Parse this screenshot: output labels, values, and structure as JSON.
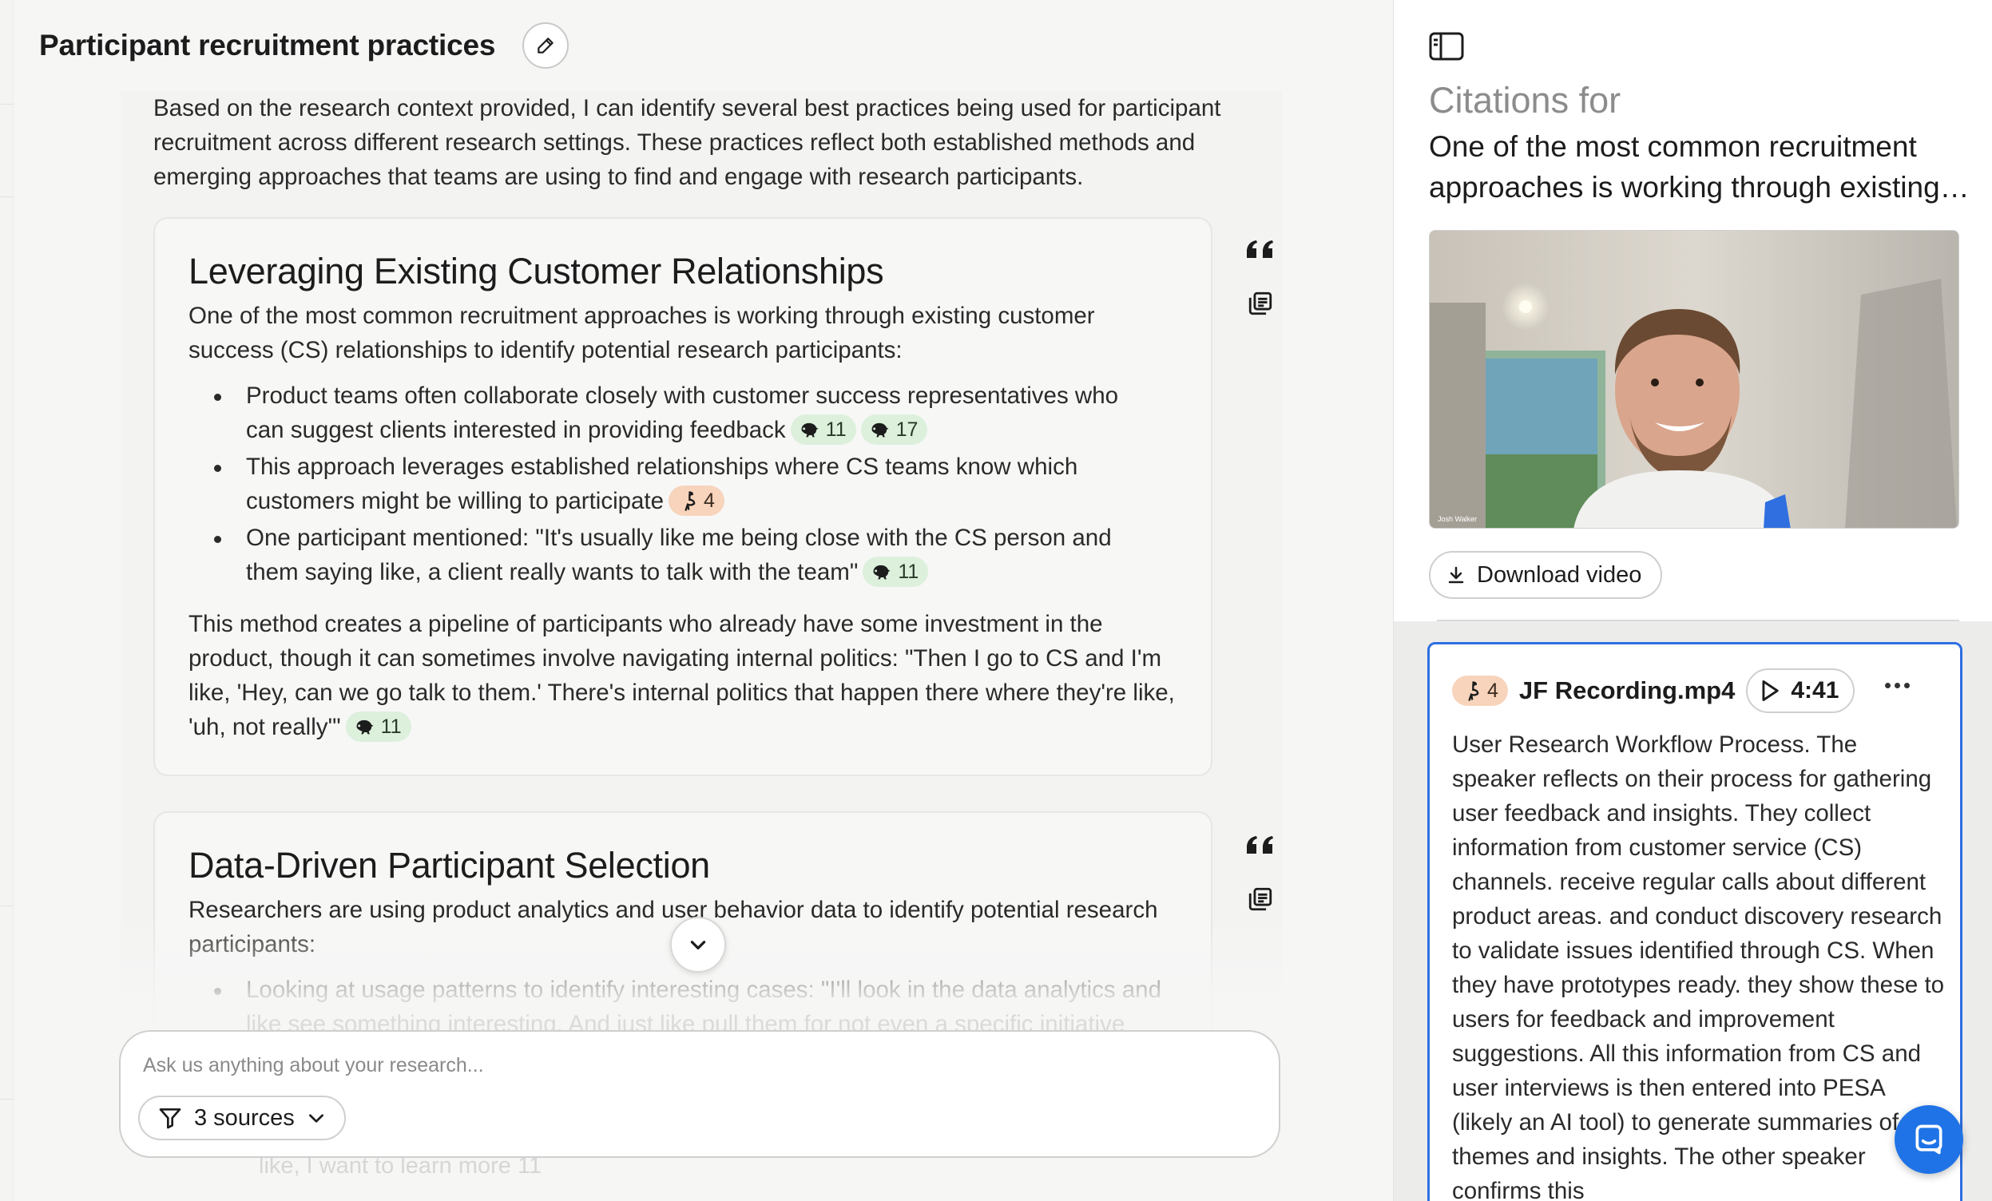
{
  "page": {
    "title": "Participant recruitment practices"
  },
  "chat": {
    "intro": "Based on the research context provided, I can identify several best practices being used for participant recruitment across different research settings. These practices reflect both established methods and emerging approaches that teams are using to find and engage with research participants.",
    "sections": [
      {
        "heading": "Leveraging Existing Customer Relationships",
        "lead": "One of the most common recruitment approaches is working through existing customer success (CS) relationships to identify potential research participants:",
        "bullets": [
          "Product teams often collaborate closely with customer success representatives who can suggest clients interested in providing feedback",
          "This approach leverages established relationships where CS teams know which customers might be willing to participate",
          "One participant mentioned: \"It's usually like me being close with the CS person and them saying like, a client really wants to talk with the team\""
        ],
        "chips": {
          "b1a": "11",
          "b1b": "17",
          "b2": "4",
          "b3": "11",
          "closing": "11"
        },
        "closing": "This method creates a pipeline of participants who already have some investment in the product, though it can sometimes involve navigating internal politics: \"Then I go to CS and I'm like, 'Hey, can we go talk to them.' There's internal politics that happen there where they're like, 'uh, not really'\""
      },
      {
        "heading": "Data-Driven Participant Selection",
        "lead": "Researchers are using product analytics and user behavior data to identify potential research participants:",
        "bullets": [
          "Looking at usage patterns to identify interesting cases: \"I'll look in the data analytics and like see something interesting. And just like pull them for not even a specific initiative"
        ]
      }
    ],
    "ghost_text": "like, I want to learn more",
    "ghost_chip": "11"
  },
  "composer": {
    "placeholder": "Ask us anything about your research...",
    "sources_label": "3 sources"
  },
  "citations": {
    "label": "Citations for",
    "quote_line1": "One of the most common recruitment",
    "quote_line2": "approaches is working through existing customer success",
    "video_person_name": "Josh Walker",
    "download_label": "Download video",
    "card": {
      "chip_count": "4",
      "filename": "JF Recording.mp4",
      "timestamp": "4:41",
      "summary": "User Research Workflow Process. The speaker reflects on their process for gathering user feedback and insights. They collect information from customer service (CS) channels. receive regular calls about different product areas. and conduct discovery research to validate issues identified through CS. When they have prototypes ready. they show these to users for feedback and improvement suggestions. All this information from CS and user interviews is then entered into PESA (likely an AI tool) to generate summaries of themes and insights. The other speaker confirms this"
    }
  },
  "icons": {
    "edit": "pencil-icon",
    "quote": "quote-icon",
    "copy": "copy-icon",
    "chevron": "chevron-down-icon",
    "filter": "filter-icon",
    "panel": "sidebar-toggle-icon",
    "download": "download-icon",
    "play": "play-icon",
    "more": "more-horizontal-icon",
    "chat": "chat-bubble-icon",
    "chameleon": "chameleon-icon",
    "ostrich": "ostrich-icon"
  },
  "colors": {
    "chip_green": "#dcf0dc",
    "chip_orange": "#f7d4bb",
    "accent_blue": "#2f6fe0",
    "fab_blue": "#1f73e6"
  }
}
